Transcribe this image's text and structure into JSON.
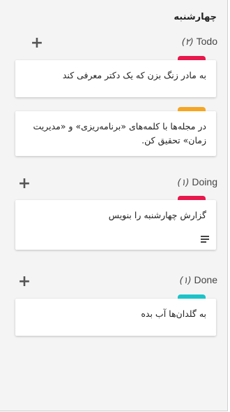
{
  "day": {
    "title": "چهارشنبه"
  },
  "groups": [
    {
      "name": "Todo",
      "count": "(۲)",
      "cards": [
        {
          "text": "به مادر زنگ بزن که یک دکتر معرفی کند",
          "tag_color": "#e8174c"
        },
        {
          "text": "در مجله‌ها با کلمه‌های «برنامه‌ریزی» و «مدیریت زمان» تحقیق کن.",
          "tag_color": "#f5a623"
        }
      ]
    },
    {
      "name": "Doing",
      "count": "(۱)",
      "cards": [
        {
          "text": "گزارش چهارشنبه را بنویس",
          "tag_color": "#e8174c",
          "has_description": true
        }
      ]
    },
    {
      "name": "Done",
      "count": "(۱)",
      "cards": [
        {
          "text": "به گلدان‌ها آب بده",
          "tag_color": "#1cc3c9"
        }
      ]
    }
  ]
}
